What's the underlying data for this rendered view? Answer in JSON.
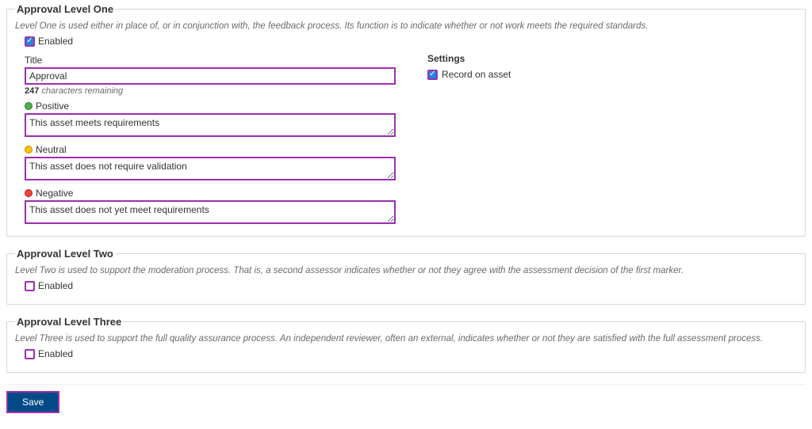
{
  "level1": {
    "legend": "Approval Level One",
    "description": "Level One is used either in place of, or in conjunction with, the feedback process. Its function is to indicate whether or not work meets the required standards.",
    "enabled_label": "Enabled",
    "title_label": "Title",
    "title_value": "Approval",
    "chars_remaining_num": "247",
    "chars_remaining_text": " characters remaining",
    "positive_label": "Positive",
    "positive_value": "This asset meets requirements",
    "neutral_label": "Neutral",
    "neutral_value": "This asset does not require validation",
    "negative_label": "Negative",
    "negative_value": "This asset does not yet meet requirements",
    "settings_label": "Settings",
    "record_on_asset_label": "Record on asset"
  },
  "level2": {
    "legend": "Approval Level Two",
    "description": "Level Two is used to support the moderation process. That is, a second assessor indicates whether or not they agree with the assessment decision of the first marker.",
    "enabled_label": "Enabled"
  },
  "level3": {
    "legend": "Approval Level Three",
    "description": "Level Three is used to support the full quality assurance process. An independent reviewer, often an external, indicates whether or not they are satisfied with the full assessment process.",
    "enabled_label": "Enabled"
  },
  "save_label": "Save"
}
